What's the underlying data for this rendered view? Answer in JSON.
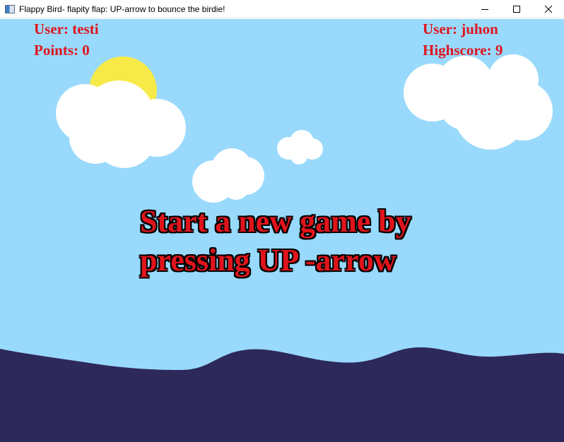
{
  "window": {
    "title": "Flappy Bird- flapity flap: UP-arrow to bounce the birdie!"
  },
  "hud": {
    "current_user": "User: testi",
    "points": "Points: 0",
    "best_user": "User: juhon",
    "highscore": "Highscore: 9"
  },
  "message": {
    "line1": "Start a new game by",
    "line2": "pressing UP -arrow"
  },
  "colors": {
    "sky": "#99d9fb",
    "sea": "#2d295b",
    "sun": "#f7ea48",
    "cloud": "#ffffff",
    "text_red": "#e0141c"
  }
}
